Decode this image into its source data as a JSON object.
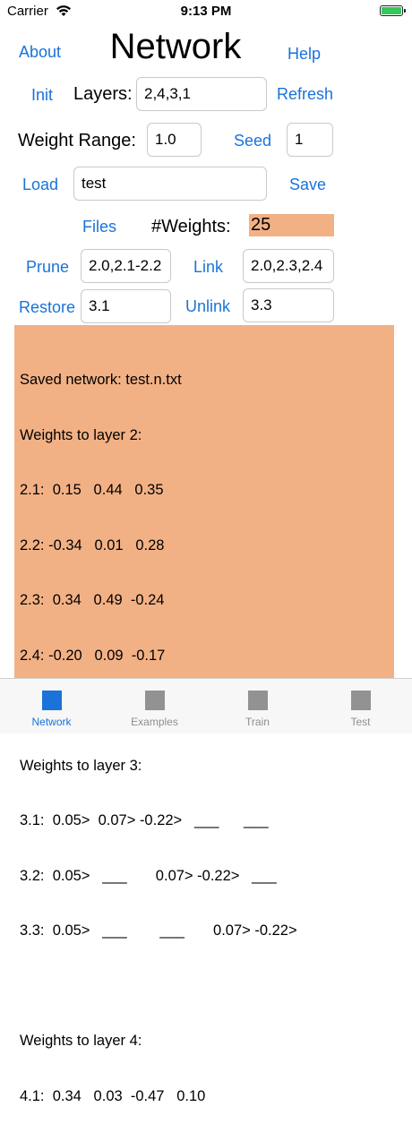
{
  "status_bar": {
    "carrier": "Carrier",
    "time": "9:13 PM"
  },
  "header": {
    "about": "About",
    "title": "Network",
    "help": "Help"
  },
  "layers_row": {
    "init": "Init",
    "label": "Layers:",
    "value": "2,4,3,1",
    "refresh": "Refresh"
  },
  "weight_row": {
    "label": "Weight Range:",
    "value": "1.0",
    "seed_label": "Seed",
    "seed_value": "1"
  },
  "file_row": {
    "load": "Load",
    "value": "test",
    "save": "Save"
  },
  "files_row": {
    "files": "Files",
    "weights_label": "#Weights:",
    "weights_value": "25",
    "weights_bg": "#f2b185"
  },
  "prune_row": {
    "prune": "Prune",
    "prune_value": "2.0,2.1-2.2",
    "link": "Link",
    "link_value": "2.0,2.3,2.4"
  },
  "restore_row": {
    "restore": "Restore",
    "restore_value": "3.1",
    "unlink": "Unlink",
    "unlink_value": "3.3"
  },
  "output": {
    "background": "#f2b185",
    "lines": [
      "Saved network: test.n.txt",
      "Weights to layer 2:",
      "2.1:  0.15   0.44   0.35",
      "2.2: -0.34   0.01   0.28",
      "2.3:  0.34   0.49  -0.24",
      "2.4: -0.20   0.09  -0.17",
      "",
      "Weights to layer 3:",
      "3.1:  0.05>  0.07> -0.22>   ___      ___",
      "3.2:  0.05>   ___       0.07> -0.22>   ___",
      "3.3:  0.05>   ___        ___       0.07> -0.22>",
      "",
      "Weights to layer 4:",
      "4.1:  0.34   0.03  -0.47   0.10"
    ]
  },
  "tabs": [
    {
      "label": "Network",
      "active": true
    },
    {
      "label": "Examples",
      "active": false
    },
    {
      "label": "Train",
      "active": false
    },
    {
      "label": "Test",
      "active": false
    }
  ],
  "colors": {
    "accent": "#1a73d9",
    "battery": "#34c759"
  }
}
